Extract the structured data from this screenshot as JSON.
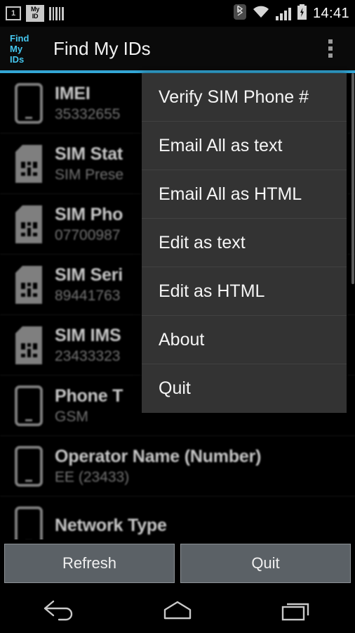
{
  "status_bar": {
    "notification_icons": [
      "sim-slot-one-icon",
      "my-id-icon",
      "barcode-icon"
    ],
    "sim_slot_label": "1",
    "my_id_line1": "My",
    "my_id_line2": "ID",
    "system_icons": [
      "bluetooth-icon",
      "wifi-icon",
      "signal-icon",
      "battery-charging-icon"
    ],
    "clock": "14:41"
  },
  "action_bar": {
    "app_icon_line1": "Find",
    "app_icon_line2": "My",
    "app_icon_line3": "IDs",
    "title": "Find My IDs",
    "overflow_label": "overflow-menu",
    "accent_color": "#33a5d4"
  },
  "overflow_menu": {
    "open": true,
    "items": [
      {
        "label": "Verify SIM Phone #"
      },
      {
        "label": "Email All as text"
      },
      {
        "label": "Email All as HTML"
      },
      {
        "label": "Edit as text"
      },
      {
        "label": "Edit as HTML"
      },
      {
        "label": "About"
      },
      {
        "label": "Quit"
      }
    ]
  },
  "info_list": {
    "rows": [
      {
        "icon": "phone-icon",
        "label": "IMEI",
        "value": "35332655"
      },
      {
        "icon": "sim-card-icon",
        "label": "SIM Stat",
        "value": "SIM Prese"
      },
      {
        "icon": "sim-card-icon",
        "label": "SIM Pho",
        "value": "07700987"
      },
      {
        "icon": "sim-card-icon",
        "label": "SIM Seri",
        "value": "89441763"
      },
      {
        "icon": "sim-card-icon",
        "label": "SIM IMS",
        "value": "23433323"
      },
      {
        "icon": "phone-icon",
        "label": "Phone T",
        "value": "GSM"
      },
      {
        "icon": "phone-icon",
        "label": "Operator Name (Number)",
        "value": "EE (23433)"
      },
      {
        "icon": "phone-icon",
        "label": "Network Type",
        "value": ""
      }
    ]
  },
  "button_bar": {
    "refresh_label": "Refresh",
    "quit_label": "Quit"
  },
  "nav_bar": {
    "buttons": [
      "back-icon",
      "home-icon",
      "recents-icon"
    ]
  }
}
